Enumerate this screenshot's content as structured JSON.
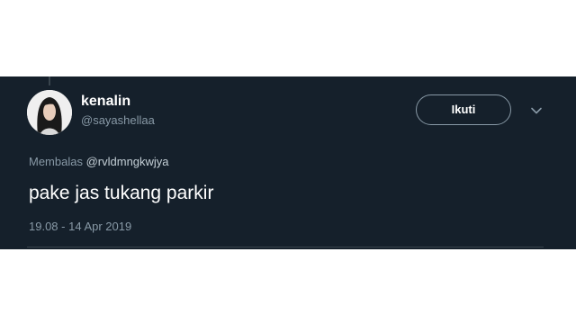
{
  "tweet": {
    "display_name": "kenalin",
    "handle": "@sayashellaa",
    "follow_label": "Ikuti",
    "reply_prefix": "Membalas",
    "reply_to": "@rvldmngkwjya",
    "text": "pake jas tukang parkir",
    "timestamp": "19.08 - 14 Apr 2019"
  },
  "icons": {
    "more": "chevron-down-icon",
    "avatar": "avatar"
  },
  "colors": {
    "background": "#15202b",
    "primary_text": "#ffffff",
    "secondary_text": "#8899a6",
    "border": "#38444d"
  }
}
